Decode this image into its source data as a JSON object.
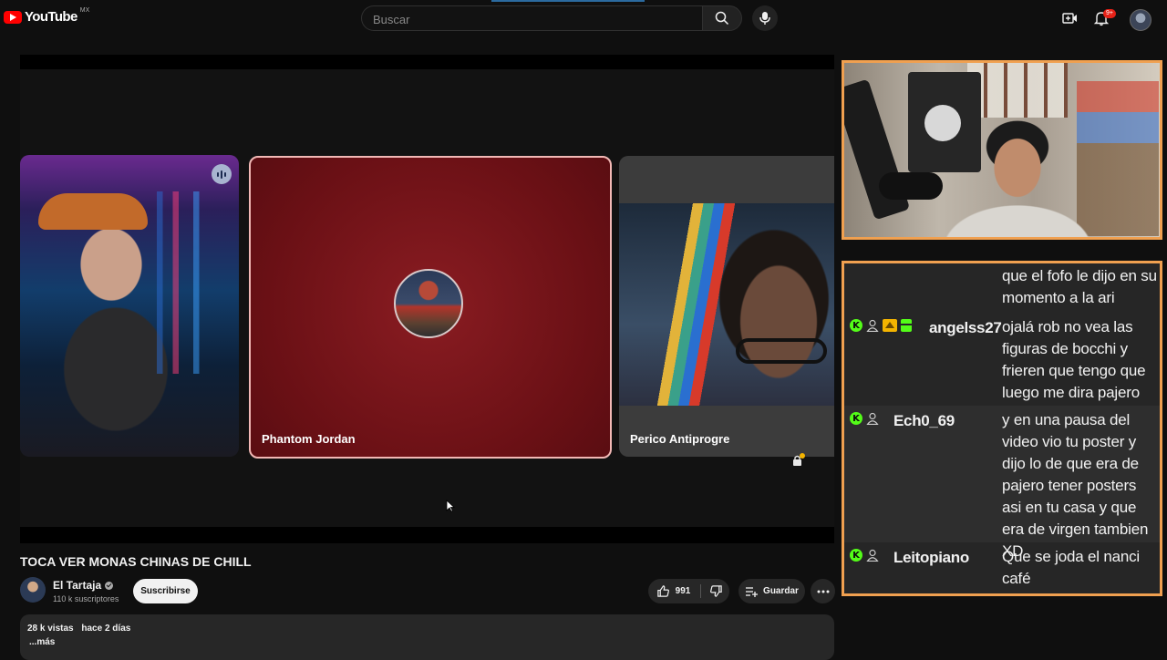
{
  "header": {
    "logo_text": "YouTube",
    "country_code": "MX",
    "search_placeholder": "Buscar",
    "notification_count": "9+",
    "accent_color": "#ff0000"
  },
  "player": {
    "participants": [
      {
        "name": "",
        "avatar": "webcam-feed"
      },
      {
        "name": "Phantom Jordan",
        "avatar": "profile-photo"
      },
      {
        "name": "Perico Antiprogre",
        "avatar": "webcam-feed"
      }
    ]
  },
  "video": {
    "title": "TOCA VER MONAS CHINAS DE CHILL",
    "channel": "El Tartaja",
    "subscribers": "110 k suscriptores",
    "subscribe_label": "Suscribirse",
    "likes": "991",
    "save_label": "Guardar",
    "views": "28 k vistas",
    "date": "hace 2 días",
    "more_label": "...más"
  },
  "chat": {
    "messages": [
      {
        "user": "",
        "text": "que el fofo le dijo en su momento a la ari",
        "badges": []
      },
      {
        "user": "angelss27",
        "text": "ojalá rob no vea las figuras de bocchi y frieren que tengo que luego me dira pajero",
        "badges": [
          "crown",
          "gift"
        ]
      },
      {
        "user": "Ech0_69",
        "text": "y en una pausa del video vio tu poster y dijo lo de que era de pajero tener posters asi en tu casa y que era de virgen tambien XD",
        "badges": []
      },
      {
        "user": "Leitopiano",
        "text": "Que se joda el nanci café",
        "badges": []
      }
    ],
    "border_color": "#f0a050",
    "platform_color": "#53fc18"
  }
}
